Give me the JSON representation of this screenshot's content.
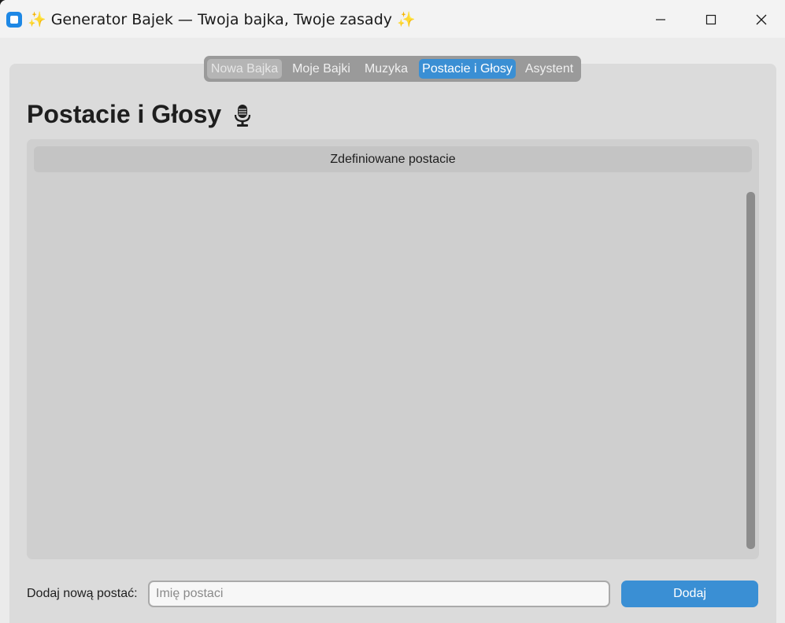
{
  "window": {
    "title": "✨ Generator Bajek — Twoja bajka, Twoje zasady ✨",
    "app_icon": "app-icon",
    "controls": [
      "minimize-icon",
      "maximize-icon",
      "close-icon"
    ]
  },
  "tabs": [
    {
      "label": "Nowa Bajka",
      "state": "disabled"
    },
    {
      "label": "Moje Bajki",
      "state": "normal"
    },
    {
      "label": "Muzyka",
      "state": "normal"
    },
    {
      "label": "Postacie i Głosy",
      "state": "selected"
    },
    {
      "label": "Asystent",
      "state": "normal"
    }
  ],
  "page": {
    "title": "Postacie i Głosy",
    "title_icon": "microphone-icon"
  },
  "characters": {
    "header": "Zdefiniowane postacie",
    "items": []
  },
  "add_character": {
    "label": "Dodaj nową postać:",
    "input_value": "",
    "input_placeholder": "Imię postaci",
    "button_label": "Dodaj"
  },
  "colors": {
    "accent": "#3a8fd4",
    "background": "#ebebeb",
    "panel": "#dbdbdb"
  }
}
